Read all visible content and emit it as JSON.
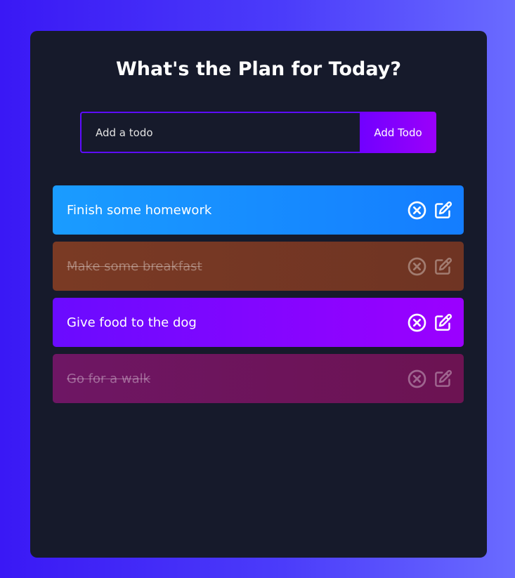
{
  "header": {
    "title": "What's the Plan for Today?"
  },
  "form": {
    "placeholder": "Add a todo",
    "value": "",
    "button_label": "Add Todo"
  },
  "colors": {
    "background_start": "#3a18f5",
    "background_end": "#6a6bff",
    "panel": "#161a2b",
    "accent": "#5d0cff"
  },
  "todos": [
    {
      "text": "Finish some homework",
      "completed": false,
      "color": "blue"
    },
    {
      "text": "Make some breakfast",
      "completed": true,
      "color": "orange"
    },
    {
      "text": "Give food to the dog",
      "completed": false,
      "color": "purple"
    },
    {
      "text": "Go for a walk",
      "completed": true,
      "color": "magenta"
    }
  ],
  "icons": {
    "delete": "close-circle-icon",
    "edit": "edit-icon"
  }
}
